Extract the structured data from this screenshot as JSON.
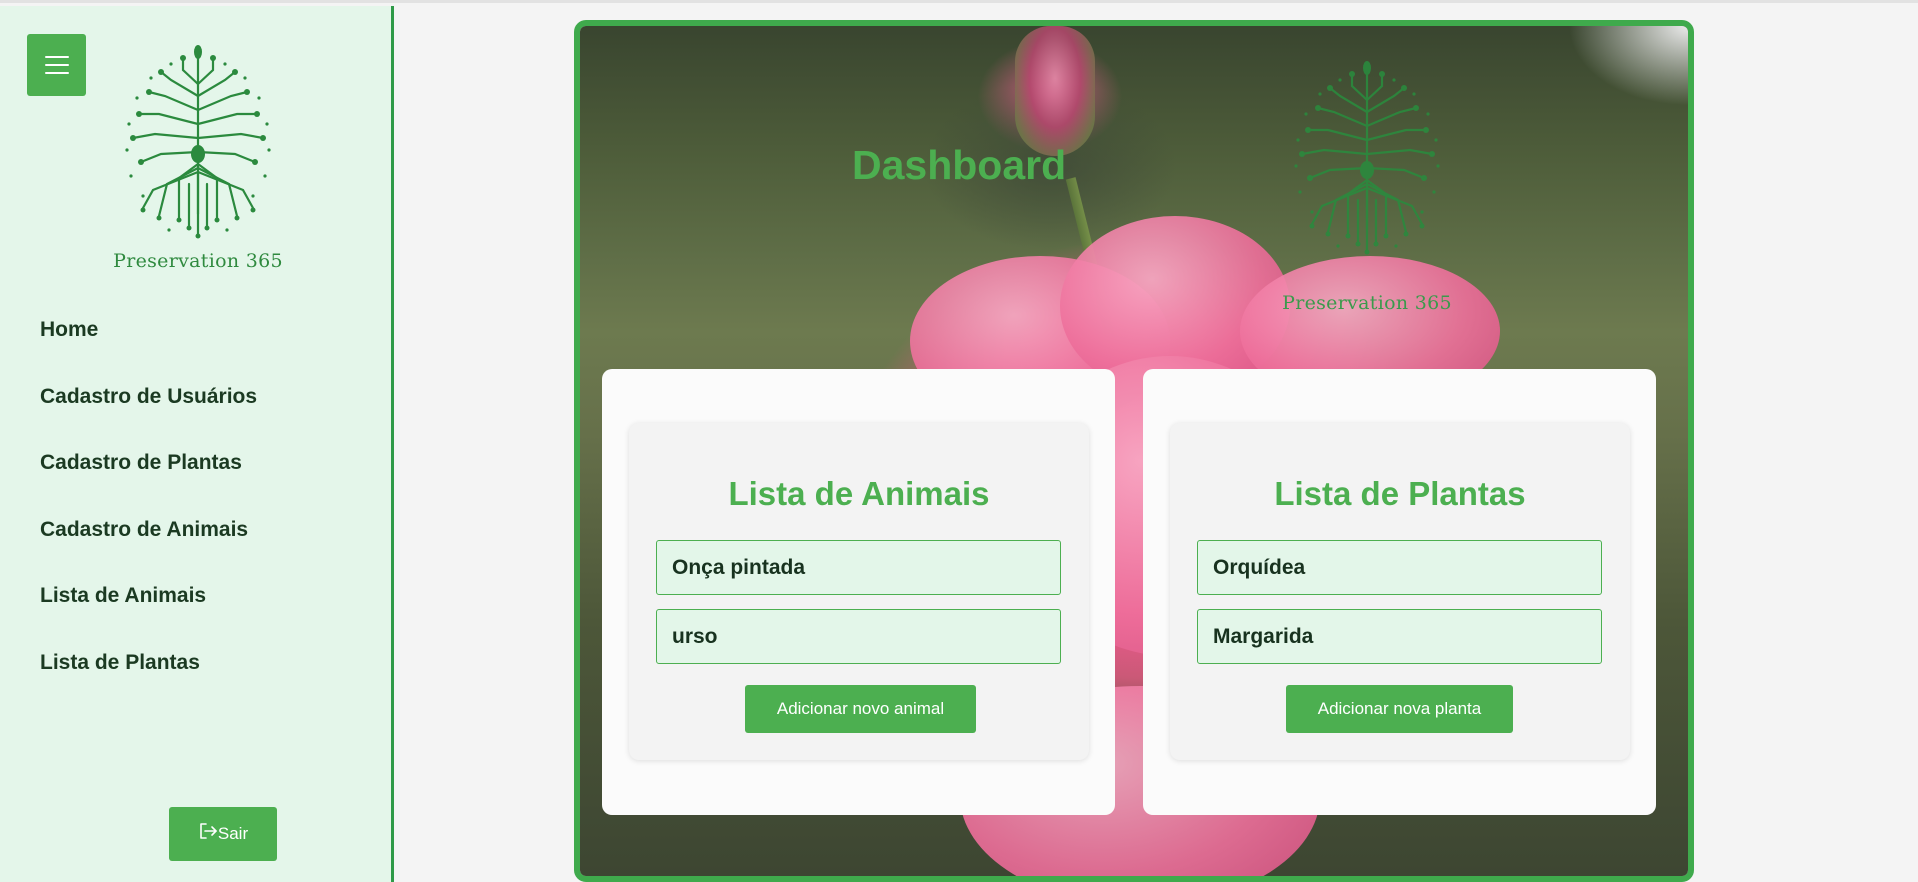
{
  "sidebar": {
    "brand": "Preservation 365",
    "nav": [
      {
        "label": "Home"
      },
      {
        "label": "Cadastro de Usuários"
      },
      {
        "label": "Cadastro de Plantas"
      },
      {
        "label": "Cadastro de Animais"
      },
      {
        "label": "Lista de Animais"
      },
      {
        "label": "Lista de Plantas"
      }
    ],
    "logout_label": "Sair"
  },
  "main": {
    "title": "Dashboard",
    "brand": "Preservation 365",
    "animals_card": {
      "heading": "Lista de Animais",
      "items": [
        "Onça pintada",
        "urso"
      ],
      "add_label": "Adicionar novo animal"
    },
    "plants_card": {
      "heading": "Lista de Plantas",
      "items": [
        "Orquídea",
        "Margarida"
      ],
      "add_label": "Adicionar nova planta"
    }
  },
  "icons": {
    "menu": "hamburger-menu-icon",
    "logout": "logout-icon",
    "logo": "circuit-tree-logo"
  },
  "colors": {
    "accent": "#4caf50",
    "sidebar_bg": "#e4f6ea",
    "item_bg": "#e3f6e9",
    "nav_text": "#1b3a22"
  }
}
